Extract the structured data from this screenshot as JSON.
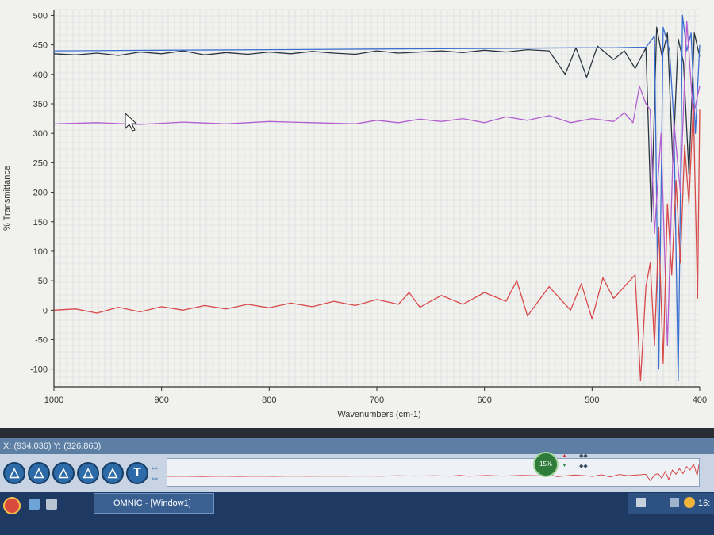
{
  "chart_data": {
    "type": "line",
    "ylabel": "% Transmittance",
    "xlabel": "Wavenumbers (cm-1)",
    "xlim": [
      1000,
      400
    ],
    "ylim": [
      -130,
      510
    ],
    "x_ticks": [
      1000,
      900,
      800,
      700,
      600,
      500,
      400
    ],
    "x_tick_labels": [
      "1000",
      "900",
      "800",
      "700",
      "600",
      "500",
      "400"
    ],
    "y_ticks": [
      500,
      450,
      400,
      350,
      300,
      250,
      200,
      150,
      100,
      50,
      0,
      -50,
      -100
    ],
    "y_tick_labels": [
      "500",
      "450",
      "400",
      "350",
      "300",
      "250",
      "200",
      "150",
      "100",
      "50",
      "-0",
      "-50",
      "-100"
    ],
    "grid": true,
    "series": [
      {
        "color": "#2a3540",
        "x": [
          1000,
          980,
          960,
          940,
          920,
          900,
          880,
          860,
          840,
          820,
          800,
          780,
          760,
          740,
          720,
          700,
          680,
          660,
          640,
          620,
          600,
          580,
          560,
          540,
          525,
          515,
          505,
          495,
          480,
          470,
          460,
          450,
          445,
          440,
          435,
          430,
          425,
          420,
          415,
          410,
          405,
          400
        ],
        "y": [
          435,
          433,
          436,
          432,
          438,
          435,
          440,
          433,
          437,
          434,
          438,
          435,
          439,
          436,
          434,
          440,
          436,
          438,
          440,
          437,
          441,
          438,
          442,
          440,
          400,
          445,
          395,
          448,
          425,
          440,
          410,
          445,
          150,
          480,
          430,
          470,
          250,
          460,
          420,
          230,
          470,
          430
        ]
      },
      {
        "color": "#3a6fd0",
        "x": [
          1000,
          900,
          800,
          700,
          600,
          520,
          480,
          460,
          450,
          442,
          438,
          434,
          428,
          424,
          420,
          416,
          412,
          408,
          404,
          400
        ],
        "y": [
          440,
          441,
          442,
          443,
          444,
          445,
          445,
          446,
          446,
          465,
          -100,
          480,
          440,
          320,
          -120,
          500,
          440,
          470,
          300,
          450
        ]
      },
      {
        "color": "#b25fd0",
        "x": [
          1000,
          960,
          920,
          880,
          840,
          800,
          760,
          720,
          700,
          680,
          660,
          640,
          620,
          600,
          580,
          560,
          540,
          520,
          500,
          480,
          470,
          462,
          456,
          450,
          446,
          442,
          436,
          430,
          424,
          418,
          412,
          406,
          400
        ],
        "y": [
          316,
          318,
          315,
          319,
          316,
          320,
          318,
          316,
          322,
          318,
          324,
          320,
          325,
          318,
          328,
          322,
          330,
          318,
          325,
          320,
          335,
          318,
          380,
          350,
          340,
          130,
          300,
          -60,
          320,
          200,
          490,
          330,
          380
        ]
      },
      {
        "color": "#d84a4a",
        "x": [
          1000,
          980,
          960,
          940,
          920,
          900,
          880,
          860,
          840,
          820,
          800,
          780,
          760,
          740,
          720,
          700,
          680,
          670,
          660,
          640,
          620,
          600,
          580,
          570,
          560,
          540,
          520,
          510,
          500,
          490,
          480,
          470,
          460,
          455,
          450,
          446,
          442,
          438,
          434,
          430,
          426,
          422,
          418,
          414,
          410,
          406,
          402,
          400
        ],
        "y": [
          0,
          2,
          -5,
          5,
          -3,
          6,
          0,
          8,
          2,
          10,
          4,
          12,
          6,
          15,
          8,
          18,
          10,
          30,
          5,
          25,
          10,
          30,
          15,
          50,
          -10,
          40,
          0,
          45,
          -15,
          55,
          20,
          40,
          60,
          -120,
          40,
          80,
          -60,
          140,
          -90,
          180,
          60,
          220,
          80,
          280,
          180,
          350,
          20,
          340
        ]
      }
    ]
  },
  "status": {
    "coordinates": "X: (934.036)  Y: (326.860)"
  },
  "toolbar": {
    "tools": [
      {
        "name": "tool-1-button",
        "glyph": "△"
      },
      {
        "name": "tool-2-button",
        "glyph": "△"
      },
      {
        "name": "tool-3-button",
        "glyph": "△"
      },
      {
        "name": "tool-4-button",
        "glyph": "△"
      },
      {
        "name": "tool-5-button",
        "glyph": "△"
      },
      {
        "name": "text-tool-button",
        "glyph": "T"
      }
    ],
    "progress_label": "15%"
  },
  "taskbar": {
    "app_title": "OMNIC - [Window1]",
    "clock": "16:"
  },
  "colors": {
    "plot_bg": "#f1f1ee",
    "grid": "#d6d9e0",
    "axis": "#303030"
  }
}
